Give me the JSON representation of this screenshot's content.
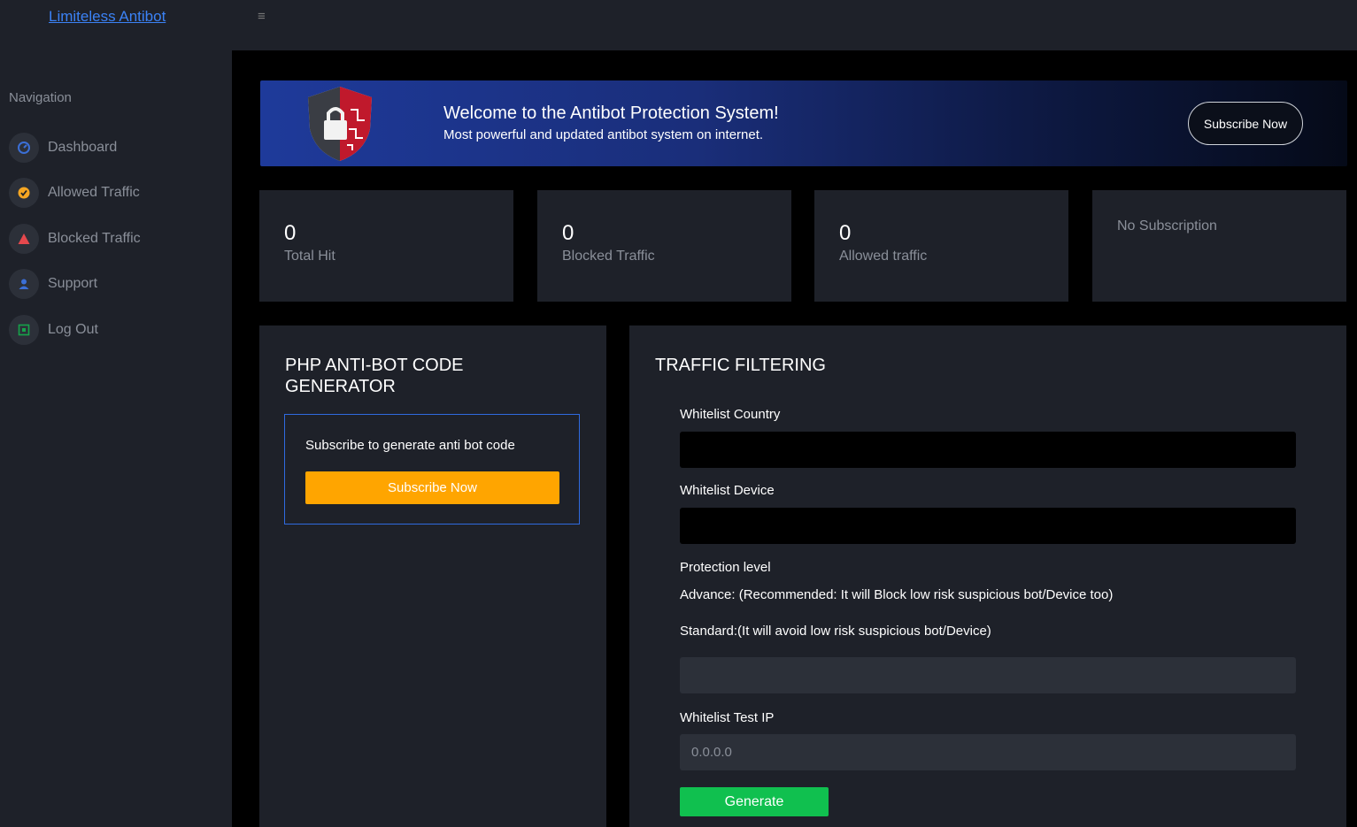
{
  "app": {
    "brand": "Limiteless Antibot",
    "menu_icon": "hamburger-icon"
  },
  "sidebar": {
    "heading": "Navigation",
    "items": [
      {
        "label": "Dashboard",
        "icon": "speedometer-icon",
        "color": "#3b6fd6"
      },
      {
        "label": "Allowed Traffic",
        "icon": "check-circle-icon",
        "color": "#f5a623"
      },
      {
        "label": "Blocked Traffic",
        "icon": "warning-triangle-icon",
        "color": "#e5484d"
      },
      {
        "label": "Support",
        "icon": "user-icon",
        "color": "#3b6fd6"
      },
      {
        "label": "Log Out",
        "icon": "exit-icon",
        "color": "#16a34a"
      }
    ]
  },
  "banner": {
    "title": "Welcome to the Antibot Protection System!",
    "subtitle": "Most powerful and updated antibot system on internet.",
    "button": "Subscribe Now",
    "logo_icon": "shield-lock-icon"
  },
  "stats": [
    {
      "value": "0",
      "label": "Total Hit"
    },
    {
      "value": "0",
      "label": "Blocked Traffic"
    },
    {
      "value": "0",
      "label": "Allowed traffic"
    },
    {
      "value": "",
      "label": "No Subscription"
    }
  ],
  "generator": {
    "title_line1": "PHP ANTI-BOT CODE",
    "title_line2": "GENERATOR",
    "text": "Subscribe to generate anti bot code",
    "button": "Subscribe Now"
  },
  "filtering": {
    "title": "TRAFFIC FILTERING",
    "whitelist_country_label": "Whitelist Country",
    "whitelist_country_value": "",
    "whitelist_device_label": "Whitelist Device",
    "whitelist_device_value": "",
    "protection_label": "Protection level",
    "advance_text": "Advance: (Recommended: It will Block low risk suspicious bot/Device too)",
    "standard_text": "Standard:(It will avoid low risk suspicious bot/Device)",
    "protection_value": "",
    "test_ip_label": "Whitelist Test IP",
    "test_ip_placeholder": "0.0.0.0",
    "generate_button": "Generate"
  }
}
